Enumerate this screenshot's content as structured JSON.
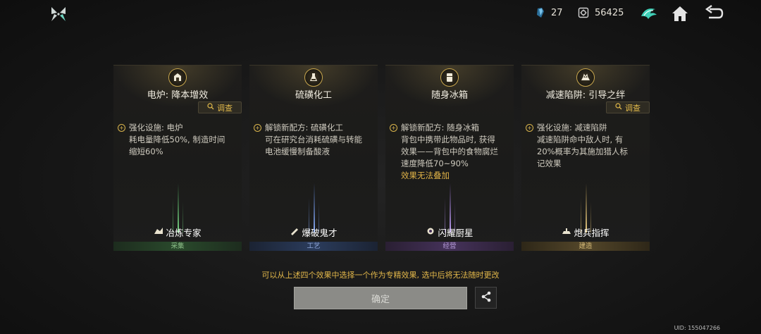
{
  "header": {
    "resource1_value": "27",
    "resource2_value": "56425"
  },
  "cards": [
    {
      "title": "电炉: 降本增效",
      "has_inspect": true,
      "inspect_label": "调查",
      "lines": [
        "强化设施: 电炉",
        "耗电量降低50%, 制造时间",
        "缩短60%"
      ],
      "highlight": "",
      "skill": "冶炼专家",
      "category": "采集",
      "beam_color": "#4fae5e"
    },
    {
      "title": "硫磺化工",
      "has_inspect": false,
      "inspect_label": "",
      "lines": [
        "解锁新配方: 硫磺化工",
        "可在研究台消耗硫磺与转能",
        "电池缓慢制备酸液"
      ],
      "highlight": "",
      "skill": "爆破鬼才",
      "category": "工艺",
      "beam_color": "#5a82d6"
    },
    {
      "title": "随身冰箱",
      "has_inspect": false,
      "inspect_label": "",
      "lines": [
        "解锁新配方: 随身冰箱",
        "背包中携带此物品时, 获得",
        "效果——背包中的食物腐烂",
        "速度降低70~90%"
      ],
      "highlight": "效果无法叠加",
      "skill": "闪耀厨星",
      "category": "经营",
      "beam_color": "#9a72d4"
    },
    {
      "title": "减速陷阱: 引导之绊",
      "has_inspect": true,
      "inspect_label": "调查",
      "lines": [
        "强化设施: 减速陷阱",
        "减速陷阱命中敌人时, 有",
        "20%概率为其施加猎人标",
        "记效果"
      ],
      "highlight": "",
      "skill": "炮兵指挥",
      "category": "建造",
      "beam_color": "#c8a658"
    }
  ],
  "hint_text": "可以从上述四个效果中选择一个作为专精效果, 选中后将无法随时更改",
  "confirm_label": "确定",
  "uid_text": "UID: 155047266",
  "colors": {
    "accent_gold": "#e0b347",
    "confirm_bg": "#8b8b87"
  },
  "icons": [
    "app-logo-icon",
    "crystal-icon",
    "gear-coin-icon",
    "emblem-icon",
    "home-icon",
    "back-icon",
    "share-icon",
    "search-icon"
  ]
}
